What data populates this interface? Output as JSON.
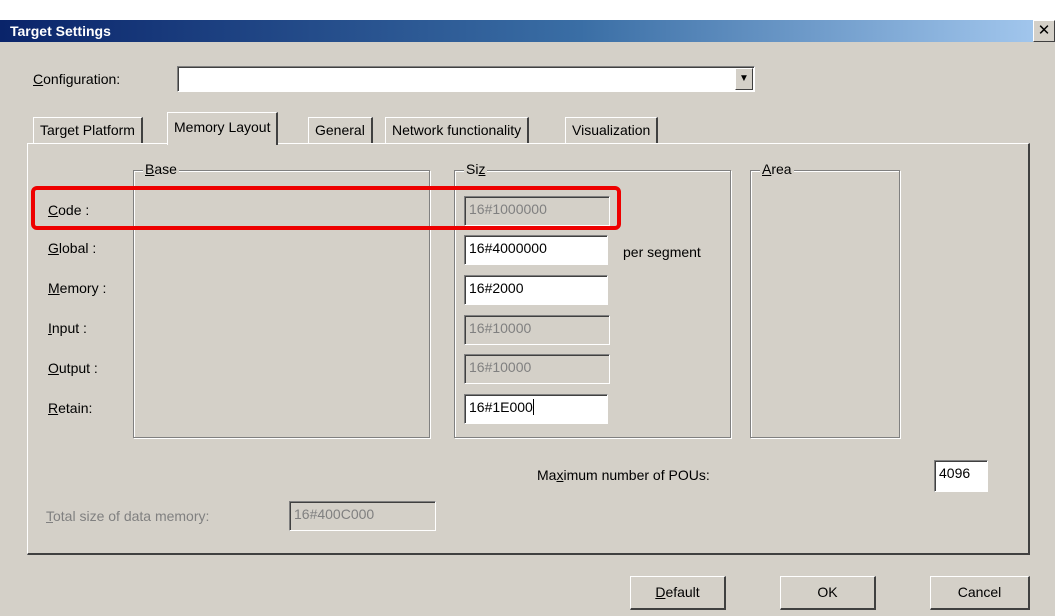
{
  "window": {
    "title": "Target Settings",
    "close_glyph": "✕"
  },
  "configuration": {
    "label": "Configuration:",
    "value": "",
    "dropdown_glyph": "▼"
  },
  "tabs": [
    {
      "label": "Target Platform",
      "active": false
    },
    {
      "label": "Memory Layout",
      "active": true
    },
    {
      "label": "General",
      "active": false
    },
    {
      "label": "Network functionality",
      "active": false
    },
    {
      "label": "Visualization",
      "active": false
    }
  ],
  "groups": {
    "base": "Base",
    "size": "Size",
    "area": "Area"
  },
  "rows": [
    {
      "label": "Code :",
      "value": "16#1000000",
      "enabled": false
    },
    {
      "label": "Global :",
      "value": "16#4000000",
      "enabled": true
    },
    {
      "label": "Memory :",
      "value": "16#2000",
      "enabled": true
    },
    {
      "label": "Input :",
      "value": "16#10000",
      "enabled": false
    },
    {
      "label": "Output :",
      "value": "16#10000",
      "enabled": false
    },
    {
      "label": "Retain:",
      "value": "16#1E000",
      "enabled": true
    }
  ],
  "per_segment": "per segment",
  "max_pous": {
    "label": "Maximum number of POUs:",
    "value": "4096"
  },
  "total_size": {
    "label": "Total size of data memory:",
    "value": "16#400C000"
  },
  "buttons": {
    "default": "Default",
    "ok": "OK",
    "cancel": "Cancel"
  },
  "colors": {
    "title_bar": "#0a246a",
    "dialog_bg": "#d4d0c8",
    "highlight": "#ee0000"
  }
}
